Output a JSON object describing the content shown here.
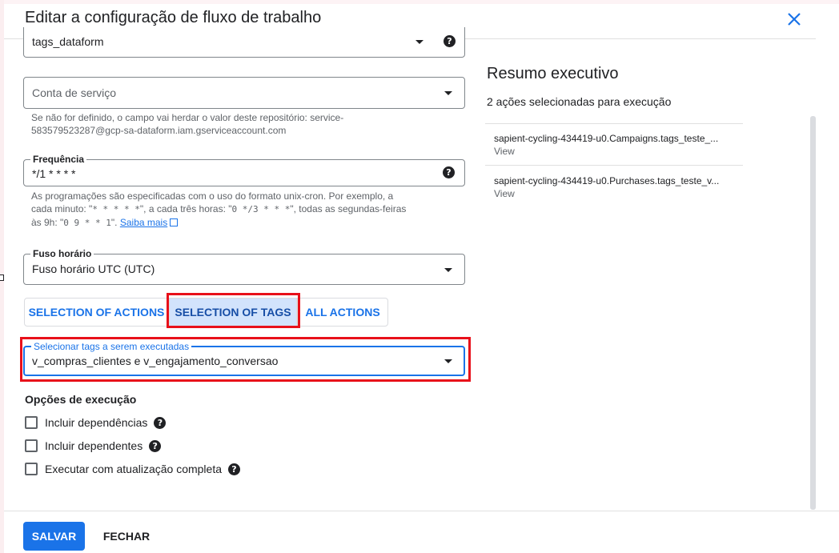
{
  "dialog": {
    "title": "Editar a configuração de fluxo de trabalho"
  },
  "form": {
    "tags_field": {
      "value": "tags_dataform"
    },
    "service_account": {
      "placeholder": "Conta de serviço",
      "hint_line1": "Se não for definido, o campo vai herdar o valor deste repositório: service-",
      "hint_line2": "583579523287@gcp-sa-dataform.iam.gserviceaccount.com"
    },
    "frequency": {
      "label": "Frequência",
      "value": "*/1 * * * *",
      "hint_line1": "As programações são especificadas com o uso do formato unix-cron. Por exemplo, a",
      "hint_line2_a": "cada minuto: \"",
      "hint_line2_code1": "* * * * *",
      "hint_line2_b": "\", a cada três horas: \"",
      "hint_line2_code2": "0 */3 * * *",
      "hint_line2_c": "\", todas as segundas-feiras",
      "hint_line3_a": "às 9h: \"",
      "hint_line3_code": "0 9 * * 1",
      "hint_line3_b": "\". ",
      "learn_more": "Saiba mais"
    },
    "timezone": {
      "label": "Fuso horário",
      "value": "Fuso horário UTC (UTC)"
    },
    "segments": {
      "actions": "SELECTION OF ACTIONS",
      "tags": "SELECTION OF TAGS",
      "all": "ALL ACTIONS"
    },
    "select_tags": {
      "label": "Selecionar tags a serem executadas",
      "value": "v_compras_clientes e v_engajamento_conversao"
    },
    "execution_options": {
      "title": "Opções de execução",
      "include_dependencies": "Incluir dependências",
      "include_dependents": "Incluir dependentes",
      "full_refresh": "Executar com atualização completa"
    }
  },
  "summary": {
    "title": "Resumo executivo",
    "count_text": "2 ações selecionadas para execução",
    "items": [
      {
        "name": "sapient-cycling-434419-u0.Campaigns.tags_teste_...",
        "link": "View"
      },
      {
        "name": "sapient-cycling-434419-u0.Purchases.tags_teste_v...",
        "link": "View"
      }
    ]
  },
  "footer": {
    "save": "SALVAR",
    "close": "FECHAR"
  },
  "colors": {
    "accent": "#1a73e8",
    "highlight_box": "#e8101a",
    "selected_segment": "#d2e3fc"
  },
  "icons": [
    "close-icon",
    "dropdown-arrow-icon",
    "help-icon",
    "external-link-icon"
  ]
}
